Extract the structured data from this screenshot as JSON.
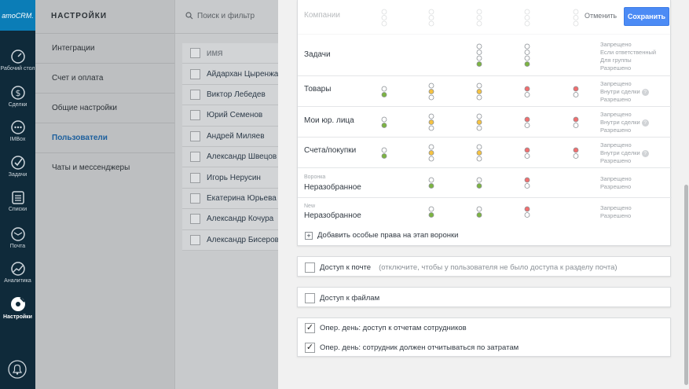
{
  "nav": {
    "logo": "amoCRM.",
    "items": [
      {
        "label": "Рабочий стол",
        "icon": "speedometer-icon"
      },
      {
        "label": "Сделки",
        "icon": "dollar-icon"
      },
      {
        "label": "IMBox",
        "icon": "chat-dots-icon"
      },
      {
        "label": "Задачи",
        "icon": "checkmark-icon"
      },
      {
        "label": "Списки",
        "icon": "list-icon"
      },
      {
        "label": "Почта",
        "icon": "envelope-icon"
      },
      {
        "label": "Аналитика",
        "icon": "line-chart-icon"
      },
      {
        "label": "Настройки",
        "icon": "gear-wrench-icon",
        "active": true
      }
    ],
    "bottom_icon": "bell-icon"
  },
  "settings": {
    "title": "НАСТРОЙКИ",
    "items": [
      {
        "label": "Интеграции"
      },
      {
        "label": "Счет и оплата"
      },
      {
        "label": "Общие настройки"
      },
      {
        "label": "Пользователи",
        "active": true
      },
      {
        "label": "Чаты и мессенджеры"
      }
    ]
  },
  "users": {
    "search_placeholder": "Поиск и фильтр",
    "column_header": "ИМЯ",
    "rows": [
      "Айдархан Цыренжапов",
      "Виктор Лебедев",
      "Юрий Семенов",
      "Андрей Миляев",
      "Александр Швецов",
      "Игорь Нерусин",
      "Екатерина Юрьева",
      "Александр Кочура",
      "Александр Бисеров"
    ]
  },
  "panel": {
    "cancel_label": "Отменить",
    "save_label": "Сохранить",
    "rows": [
      {
        "label": "Компании",
        "legend": []
      },
      {
        "label": "Задачи",
        "legend": [
          "Запрещено",
          "Если ответственный",
          "Для группы",
          "Разрешено"
        ]
      },
      {
        "label": "Товары",
        "legend": [
          "Запрещено",
          "Внутри сделки",
          "Разрешено"
        ]
      },
      {
        "label": "Мои юр. лица",
        "legend": [
          "Запрещено",
          "Внутри сделки",
          "Разрешено"
        ]
      },
      {
        "label": "Счета/покупки",
        "legend": [
          "Запрещено",
          "Внутри сделки",
          "Разрешено"
        ]
      },
      {
        "sublabel": "Воронка",
        "label": "Неразобранное",
        "legend": [
          "Запрещено",
          "Разрешено"
        ]
      },
      {
        "sublabel": "New",
        "label": "Неразобранное",
        "legend": [
          "Запрещено",
          "Разрешено"
        ]
      }
    ],
    "add_stage_label": "Добавить особые права на этап воронки",
    "mail_access": {
      "label": "Доступ к почте",
      "note": "(отключите, чтобы у пользователя не было доступа к разделу почта)",
      "checked": false
    },
    "files_access": {
      "label": "Доступ к файлам",
      "checked": false
    },
    "oper_report": {
      "label": "Опер. день: доступ к отчетам сотрудников",
      "checked": true
    },
    "oper_expenses": {
      "label": "Опер. день: сотрудник должен отчитываться по затратам",
      "checked": true
    },
    "colors": {
      "green": "#7cb342",
      "yellow": "#f5c242",
      "red": "#f06f6f",
      "accent": "#4c8bf5"
    }
  }
}
